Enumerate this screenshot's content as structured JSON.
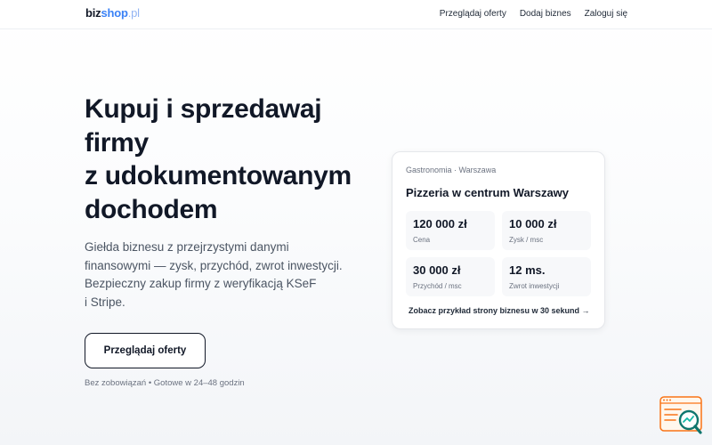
{
  "header": {
    "logo": {
      "part1": "biz",
      "part2": "shop",
      "part3": ".pl"
    },
    "nav": [
      {
        "label": "Przeglądaj oferty"
      },
      {
        "label": "Dodaj biznes"
      },
      {
        "label": "Zaloguj się"
      }
    ]
  },
  "hero": {
    "title_lines": [
      "Kupuj i sprzedawaj",
      "firmy",
      "z udokumentowanym",
      "dochodem"
    ],
    "description_lines": [
      "Giełda biznesu z przejrzystymi danymi",
      "finansowymi — zysk, przychód, zwrot inwestycji.",
      "Bezpieczny zakup firmy z weryfikacją KSeF",
      "i Stripe."
    ],
    "cta_label": "Przeglądaj oferty",
    "note": "Bez zobowiązań • Gotowe w 24–48 godzin"
  },
  "card": {
    "category": "Gastronomia · Warszawa",
    "title": "Pizzeria w centrum Warszawy",
    "stats": [
      {
        "value": "120 000 zł",
        "label": "Cena"
      },
      {
        "value": "10 000 zł",
        "label": "Zysk / msc"
      },
      {
        "value": "30 000 zł",
        "label": "Przychód / msc"
      },
      {
        "value": "12 ms.",
        "label": "Zwrot inwestycji"
      }
    ],
    "link": "Zobacz przykład strony biznesu w 30 sekund →"
  },
  "colors": {
    "brand_dark": "#111827",
    "brand_blue": "#3b82f6",
    "widget_accent": "#f97316",
    "widget_teal": "#14b8a6"
  },
  "icons": {
    "widget": "search-analytics-icon"
  }
}
